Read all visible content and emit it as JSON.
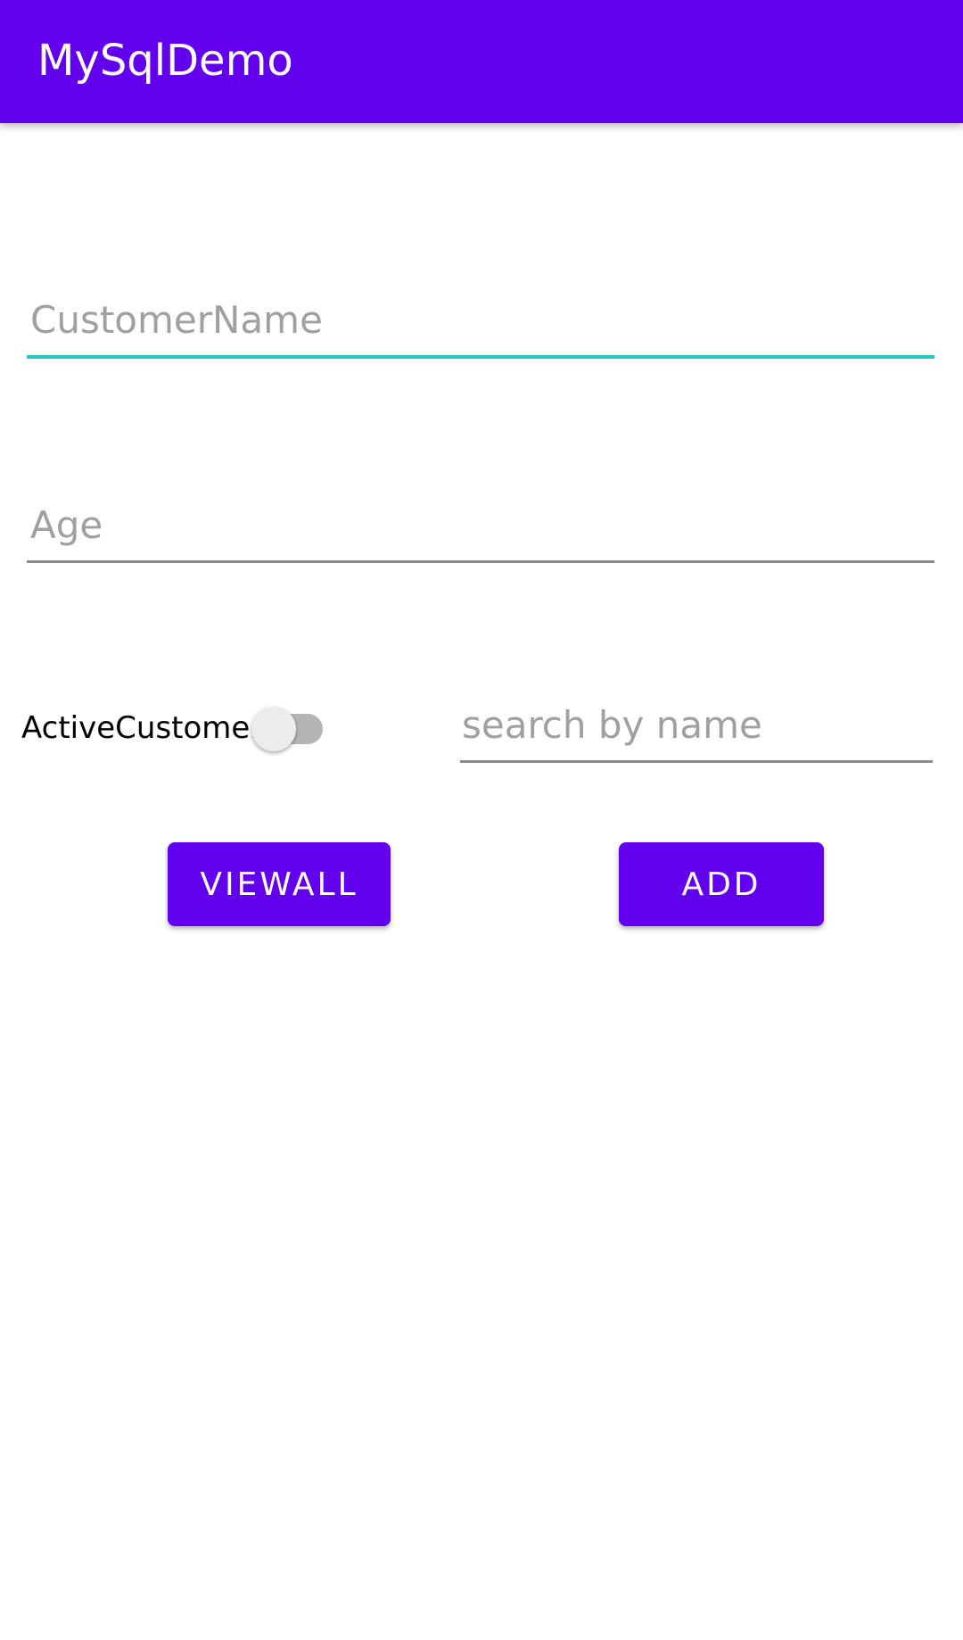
{
  "app_bar": {
    "title": "MySqlDemo",
    "color": "#6200EE"
  },
  "form": {
    "customer_name": {
      "value": "",
      "placeholder": "CustomerName",
      "focused": true
    },
    "age": {
      "value": "",
      "placeholder": "Age"
    },
    "active_customer": {
      "label": "ActiveCustomer",
      "checked": false
    },
    "search": {
      "value": "",
      "placeholder": "search by name"
    }
  },
  "buttons": {
    "viewall_label": "VIEWALL",
    "add_label": "ADD"
  },
  "colors": {
    "primary": "#6200EE",
    "focus_accent": "#1FCBC0"
  }
}
